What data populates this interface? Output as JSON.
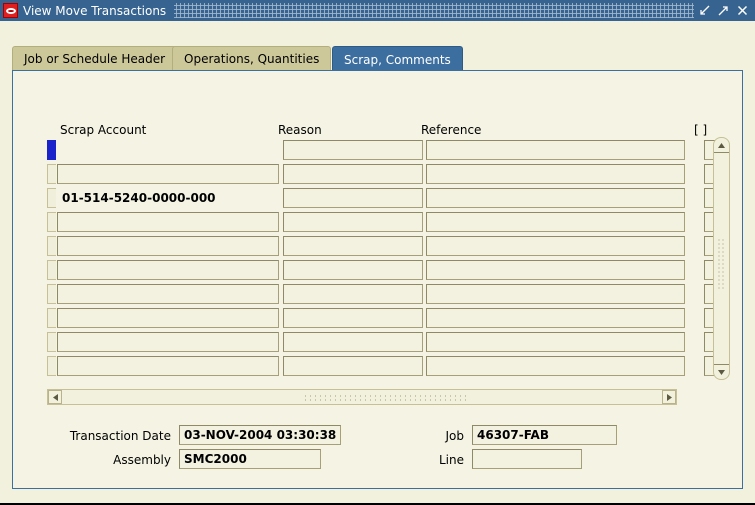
{
  "window": {
    "title": "View Move Transactions",
    "icon": "oracle-logo-icon",
    "buttons": {
      "minimize": "minimize-icon",
      "maximize": "maximize-icon",
      "close": "close-icon"
    }
  },
  "tabs": [
    {
      "label": "Job or Schedule Header",
      "active": false
    },
    {
      "label": "Operations, Quantities",
      "active": false
    },
    {
      "label": "Scrap, Comments",
      "active": true
    }
  ],
  "grid": {
    "columns": [
      {
        "label": "Scrap Account"
      },
      {
        "label": "Reason"
      },
      {
        "label": "Reference"
      },
      {
        "label": "[ ]"
      }
    ],
    "rows": [
      {
        "current": true,
        "scrap_account": "",
        "reason": "",
        "reference": "",
        "flag": ""
      },
      {
        "current": false,
        "scrap_account": "",
        "reason": "",
        "reference": "",
        "flag": ""
      },
      {
        "current": false,
        "scrap_account": "01-514-5240-0000-000",
        "reason": "",
        "reference": "",
        "flag": "",
        "borderless": true
      },
      {
        "current": false,
        "scrap_account": "",
        "reason": "",
        "reference": "",
        "flag": ""
      },
      {
        "current": false,
        "scrap_account": "",
        "reason": "",
        "reference": "",
        "flag": ""
      },
      {
        "current": false,
        "scrap_account": "",
        "reason": "",
        "reference": "",
        "flag": ""
      },
      {
        "current": false,
        "scrap_account": "",
        "reason": "",
        "reference": "",
        "flag": ""
      },
      {
        "current": false,
        "scrap_account": "",
        "reason": "",
        "reference": "",
        "flag": ""
      },
      {
        "current": false,
        "scrap_account": "",
        "reason": "",
        "reference": "",
        "flag": ""
      },
      {
        "current": false,
        "scrap_account": "",
        "reason": "",
        "reference": "",
        "flag": ""
      }
    ]
  },
  "footer": {
    "transaction_date_label": "Transaction Date",
    "transaction_date_value": "03-NOV-2004 03:30:38",
    "assembly_label": "Assembly",
    "assembly_value": "SMC2000",
    "job_label": "Job",
    "job_value": "46307-FAB",
    "line_label": "Line",
    "line_value": ""
  },
  "colors": {
    "titlebar": "#36638f",
    "active_tab": "#3c6e9f",
    "inactive_tab": "#cdc89a",
    "canvas": "#f5f4e4",
    "window_bg": "#f2f1dd",
    "record_indicator": "#1a22cc"
  }
}
